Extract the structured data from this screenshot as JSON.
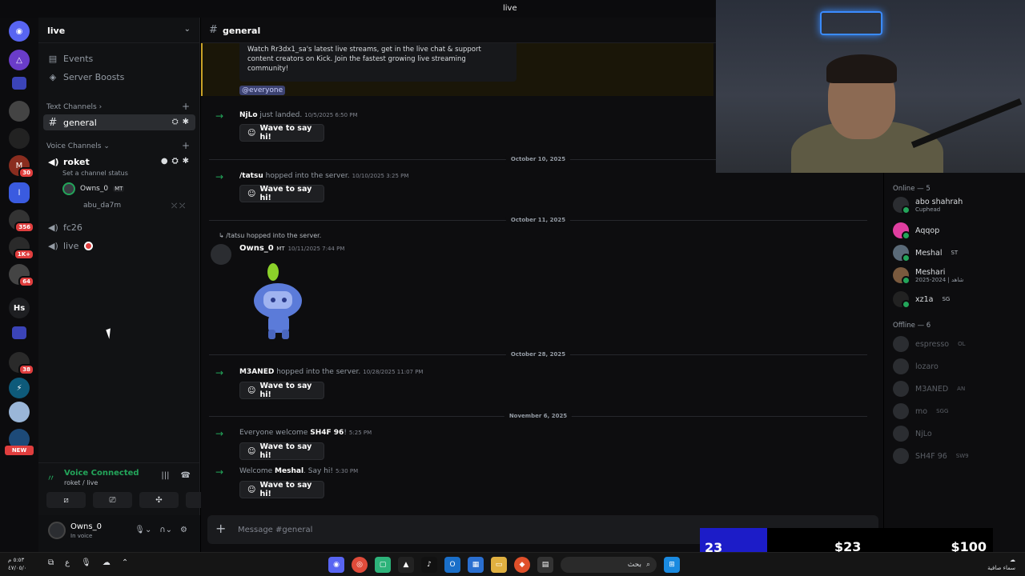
{
  "window": {
    "title": "live"
  },
  "rail": {
    "badges": [
      "30",
      "356",
      "1K+",
      "64",
      "38"
    ],
    "hs_label": "Hs",
    "new_label": "NEW"
  },
  "server": {
    "name": "live"
  },
  "sidebar": {
    "events": "Events",
    "boosts": "Server Boosts",
    "text_category": "Text Channels",
    "voice_category": "Voice Channels",
    "general": "general",
    "roket": "roket",
    "channel_status": "Set a channel status",
    "voice_user_1": "Owns_0",
    "voice_user_1_tag": "MT",
    "voice_user_2": "abu_da7m",
    "fc26": "fc26",
    "live": "live"
  },
  "voice_panel": {
    "status": "Voice Connected",
    "location": "roket / live"
  },
  "user_panel": {
    "name": "Owns_0",
    "status": "In voice"
  },
  "chat": {
    "channel": "general",
    "embed_text": "Watch Rr3dx1_sa's latest live streams, get in the live chat & support content creators on Kick. Join the fastest growing live streaming community!",
    "mention": "@everyone",
    "wave_label": "Wave to say hi!",
    "messages": [
      {
        "user": "NjLo",
        "text": "just landed.",
        "time": "10/5/2025 6:50 PM"
      },
      {
        "user": "/tatsu",
        "text": "hopped into the server.",
        "time": "10/10/2025 3:25 PM"
      },
      {
        "user": "M3ANED",
        "text": "hopped into the server.",
        "time": "10/28/2025 11:07 PM"
      }
    ],
    "dividers": [
      "October 10, 2025",
      "October 11, 2025",
      "October 28, 2025",
      "November 6, 2025"
    ],
    "reply_text": "/tatsu hopped into the server.",
    "owner_msg": {
      "user": "Owns_0",
      "tag": "MT",
      "time": "10/11/2025 7:44 PM"
    },
    "welcome1": {
      "pre": "Everyone welcome",
      "user": "SH4F 96",
      "post": "!",
      "time": "5:25 PM"
    },
    "welcome2": {
      "pre": "Welcome",
      "user": "Meshal",
      "post": ". Say hi!",
      "time": "5:30 PM"
    },
    "composer_placeholder": "Message #general"
  },
  "members": {
    "online_header": "Online — 5",
    "offline_header": "Offline — 6",
    "online": [
      {
        "name": "abo shahrah",
        "sub": "Cuphead",
        "tag": ""
      },
      {
        "name": "Aqqop",
        "sub": "",
        "tag": ""
      },
      {
        "name": "Meshal",
        "sub": "",
        "tag": "ST"
      },
      {
        "name": "Meshari",
        "sub": "2025-2024 | شاهد",
        "tag": ""
      },
      {
        "name": "xz1a",
        "sub": "",
        "tag": "SG"
      }
    ],
    "offline": [
      {
        "name": "espresso",
        "tag": "OL"
      },
      {
        "name": "lozaro",
        "tag": ""
      },
      {
        "name": "M3ANED",
        "tag": "AN"
      },
      {
        "name": "mo",
        "tag": "SGG"
      },
      {
        "name": "NjLo",
        "tag": ""
      },
      {
        "name": "SH4F 96",
        "tag": "SW9"
      }
    ]
  },
  "donation": {
    "count": "23",
    "amount1": "$23",
    "amount2": "$100"
  },
  "taskbar": {
    "clock_time": "٥:٥٣ م",
    "clock_date": "٤٧/٠٥/٠",
    "lang": "ع",
    "search": "بحث",
    "weather": "سماء صافية"
  }
}
